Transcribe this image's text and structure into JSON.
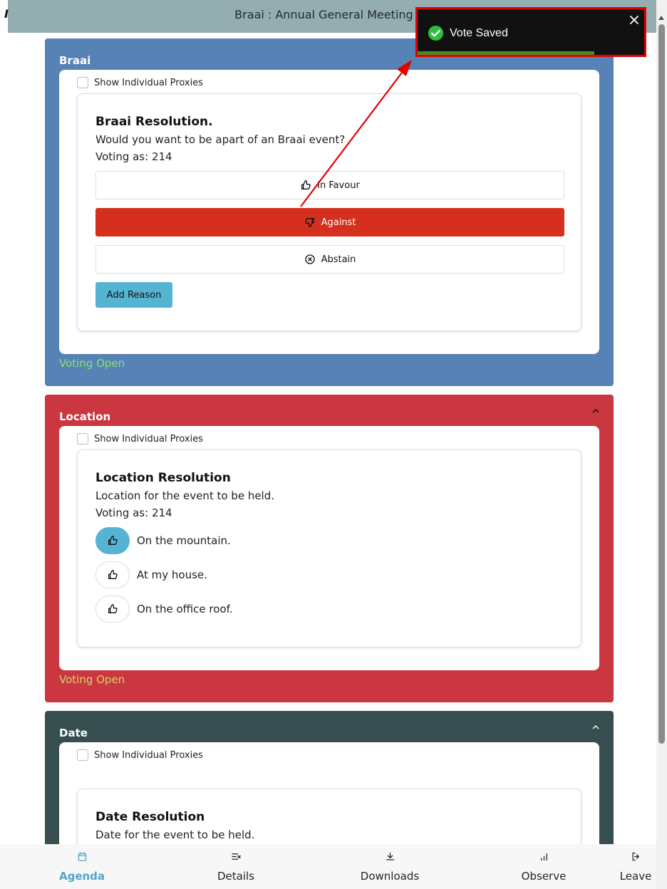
{
  "header": {
    "title": "Braai : Annual General Meeting - 2",
    "left_fragment": "I"
  },
  "toast": {
    "message": "Vote Saved",
    "icon": "check-circle-icon",
    "progress": 0.78,
    "color_success": "#2ebd3c",
    "color_highlight": "#e50000"
  },
  "sections": [
    {
      "name": "Braai",
      "color": "#5682b5",
      "show_proxies_label": "Show Individual Proxies",
      "resolution": {
        "title": "Braai Resolution.",
        "description": "Would you want to be apart of an Braai event?",
        "voting_as": "Voting as: 214",
        "options": [
          {
            "label": "In Favour",
            "icon": "thumbs-up-icon",
            "selected": false
          },
          {
            "label": "Against",
            "icon": "thumbs-down-icon",
            "selected": true
          },
          {
            "label": "Abstain",
            "icon": "x-circle-icon",
            "selected": false
          }
        ],
        "add_reason_label": "Add Reason"
      },
      "status": "Voting Open",
      "status_color": "#8ee06a"
    },
    {
      "name": "Location",
      "color": "#cb3740",
      "show_proxies_label": "Show Individual Proxies",
      "resolution": {
        "title": "Location Resolution",
        "description": "Location for the event to be held.",
        "voting_as": "Voting as: 214",
        "options": [
          {
            "label": "On the mountain.",
            "icon": "thumbs-up-icon",
            "selected": true
          },
          {
            "label": "At my house.",
            "icon": "thumbs-up-icon",
            "selected": false
          },
          {
            "label": "On the office roof.",
            "icon": "thumbs-up-icon",
            "selected": false
          }
        ]
      },
      "status": "Voting Open",
      "status_color": "#d7d26a"
    },
    {
      "name": "Date",
      "color": "#364e50",
      "show_proxies_label": "Show Individual Proxies",
      "resolution": {
        "title": "Date Resolution",
        "description": "Date for the event to be held."
      }
    }
  ],
  "bottom_nav": [
    {
      "label": "Agenda",
      "icon": "calendar-icon",
      "active": true
    },
    {
      "label": "Details",
      "icon": "list-details-icon",
      "active": false
    },
    {
      "label": "Downloads",
      "icon": "download-icon",
      "active": false
    },
    {
      "label": "Observe",
      "icon": "bar-chart-icon",
      "active": false
    },
    {
      "label": "Leave",
      "icon": "logout-icon",
      "active": false
    }
  ],
  "colors": {
    "accent": "#56b4d3",
    "against": "#d52f1d",
    "header_bg": "#94adb0"
  }
}
